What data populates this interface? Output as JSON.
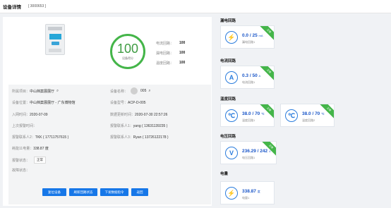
{
  "header": {
    "title": "设备详情",
    "device_code": "[ 3000653 ]"
  },
  "summary": {
    "score": "100",
    "score_label": "设备得分",
    "scores": [
      {
        "label": "电流回路：",
        "value": "100"
      },
      {
        "label": "漏电回路：",
        "value": "100"
      },
      {
        "label": "温度回路：",
        "value": "100"
      }
    ]
  },
  "info": {
    "project_label": "所属项目：",
    "project_value": "中山档案展展厅",
    "device_name_label": "设备名称：",
    "device_name_value": "005",
    "location_label": "设备位置：",
    "location_value": "中山档案展展厅 - 广东博物馆",
    "model_label": "设备型号：",
    "model_value": "ACP-D-005",
    "install_date_label": "入网时间：",
    "install_date_value": "2020-07-09",
    "latest_time_label": "数据更新时间：",
    "latest_time_value": "2020-07-30 22:57:26",
    "last_report_label": "上次报警时间：",
    "last_report_value": "",
    "alarm_contact1_label": "报警联系人1：",
    "alarm_contact1_value": "yang ( 13631139235 )",
    "contact2_label": "报警联系人2：",
    "contact2_value": "TKK ( 17711757615 )",
    "contact3_label": "报警联系人3：",
    "contact3_value": "Ryan ( 13726122178 )",
    "energy_label": "耗能11电量：",
    "energy_value": "338.87 度",
    "status_label": "报警状态：",
    "status_value": "正常",
    "fault_label": "故障状态：",
    "fault_value": ""
  },
  "actions": {
    "reset": "复位设备",
    "refresh": "刷新回路状态",
    "issue": "下发数据指令",
    "back": "返回"
  },
  "sections": {
    "leakage": "漏电回路",
    "current": "电流回路",
    "temperature": "温度回路",
    "voltage": "电压回路",
    "energy": "电量"
  },
  "cards": {
    "leakage": {
      "value": "0.0 / 25",
      "unit": "mA",
      "label": "漏电回路1",
      "badge": "正常"
    },
    "current": {
      "value": "0.3 / 50",
      "unit": "A",
      "label": "电流回路1",
      "badge": "正常"
    },
    "temp1": {
      "value": "38.0 / 70",
      "unit": "℃",
      "label": "温度回路1",
      "badge": "正常"
    },
    "temp2": {
      "value": "38.0 / 70",
      "unit": "℃",
      "label": "温度回路2",
      "badge": "正常"
    },
    "voltage": {
      "value": "236.29 / 242",
      "unit": "V",
      "label": "电压回路1",
      "badge": "正常"
    },
    "energy": {
      "value": "338.87",
      "unit": "度",
      "label": "电量1"
    }
  },
  "icons": {
    "leakage": "lightning-icon",
    "current": "ampere-icon",
    "temperature": "thermometer-icon",
    "voltage": "volt-icon",
    "energy": "lightning-icon"
  },
  "colors": {
    "accent": "#1677e8",
    "ok": "#44b549",
    "value": "#1a56c8"
  }
}
